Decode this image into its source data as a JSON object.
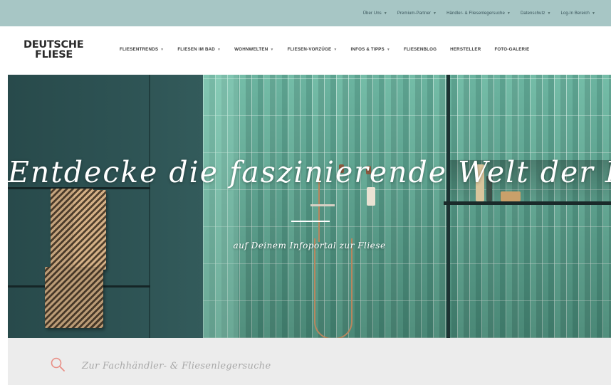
{
  "topnav": {
    "items": [
      {
        "label": "Über Uns",
        "has_dropdown": true
      },
      {
        "label": "Premium-Partner",
        "has_dropdown": true
      },
      {
        "label": "Händler- & Fliesenlegersuche",
        "has_dropdown": true
      },
      {
        "label": "Datenschutz",
        "has_dropdown": true
      },
      {
        "label": "Log-In Bereich",
        "has_dropdown": true
      }
    ]
  },
  "logo": {
    "line1": "DEUTSCHE",
    "line2": "FLIESE"
  },
  "mainnav": {
    "items": [
      {
        "label": "FLIESENTRENDS",
        "has_dropdown": true
      },
      {
        "label": "FLIESEN IM BAD",
        "has_dropdown": true
      },
      {
        "label": "WOHNWELTEN",
        "has_dropdown": true
      },
      {
        "label": "FLIESEN-VORZÜGE",
        "has_dropdown": true
      },
      {
        "label": "INFOS & TIPPS",
        "has_dropdown": true
      },
      {
        "label": "FLIESENBLOG",
        "has_dropdown": false
      },
      {
        "label": "HERSTELLER",
        "has_dropdown": false
      },
      {
        "label": "FOTO-GALERIE",
        "has_dropdown": false
      }
    ]
  },
  "hero": {
    "title": "Entdecke die faszinierende Welt der Fliese",
    "subtitle": "auf Deinem Infoportal zur Fliese"
  },
  "search": {
    "label": "Zur Fachhändler- & Fliesenlegersuche",
    "icon": "search-icon"
  },
  "colors": {
    "topbar": "#a7c6c5",
    "accent_search_icon": "#e98f86",
    "tile_green": "#5aa691",
    "dark_wall": "#284a4b"
  }
}
